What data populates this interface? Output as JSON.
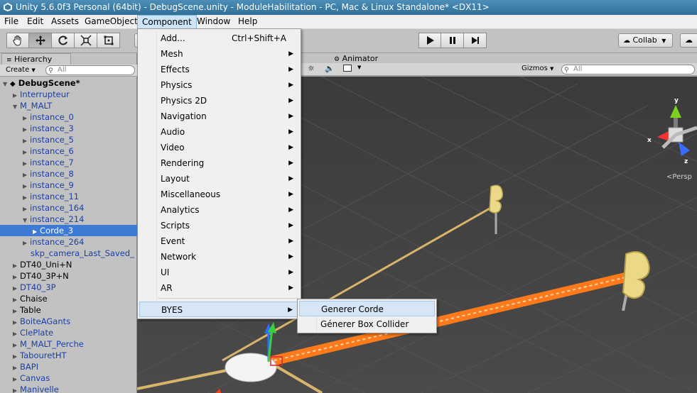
{
  "window": {
    "title": "Unity 5.6.0f3 Personal (64bit) - DebugScene.unity - ModuleHabilitation - PC, Mac & Linux Standalone* <DX11>"
  },
  "menubar": [
    "File",
    "Edit",
    "Assets",
    "GameObject",
    "Component",
    "Window",
    "Help"
  ],
  "toolbar": {
    "collab_label": "Collab"
  },
  "hierarchy": {
    "tab_label": "Hierarchy",
    "create_label": "Create",
    "search_placeholder": "All",
    "scene_name": "DebugScene*",
    "rows": [
      "Interrupteur",
      "M_MALT",
      "instance_0",
      "instance_3",
      "instance_5",
      "instance_6",
      "instance_7",
      "instance_8",
      "instance_9",
      "instance_11",
      "instance_164",
      "instance_214",
      "Corde_3",
      "instance_264",
      "skp_camera_Last_Saved_",
      "DT40_Uni+N",
      "DT40_3P+N",
      "DT40_3P",
      "Chaise",
      "Table",
      "BoiteAGants",
      "ClePlate",
      "M_MALT_Perche",
      "TabouretHT",
      "BAPI",
      "Canvas",
      "Manivelle"
    ],
    "selected": "Corde_3"
  },
  "scene": {
    "animator_tab": "Animator",
    "gizmos_label": "Gizmos",
    "search_placeholder": "All",
    "persp_label": "Persp",
    "axes": [
      "x",
      "y",
      "z"
    ]
  },
  "component_menu": {
    "items": [
      {
        "label": "Add...",
        "shortcut": "Ctrl+Shift+A"
      },
      {
        "label": "Mesh"
      },
      {
        "label": "Effects"
      },
      {
        "label": "Physics"
      },
      {
        "label": "Physics 2D"
      },
      {
        "label": "Navigation"
      },
      {
        "label": "Audio"
      },
      {
        "label": "Video"
      },
      {
        "label": "Rendering"
      },
      {
        "label": "Layout"
      },
      {
        "label": "Miscellaneous"
      },
      {
        "label": "Analytics"
      },
      {
        "label": "Scripts"
      },
      {
        "label": "Event"
      },
      {
        "label": "Network"
      },
      {
        "label": "UI"
      },
      {
        "label": "AR"
      },
      {
        "label": "BYES"
      }
    ]
  },
  "byes_submenu": {
    "items": [
      "Generer Corde",
      "Génerer Box Collider"
    ]
  },
  "colors": {
    "selection": "#3d7ad6",
    "rope": "#ff7a1a",
    "title_bar": "#3a7aa6"
  }
}
